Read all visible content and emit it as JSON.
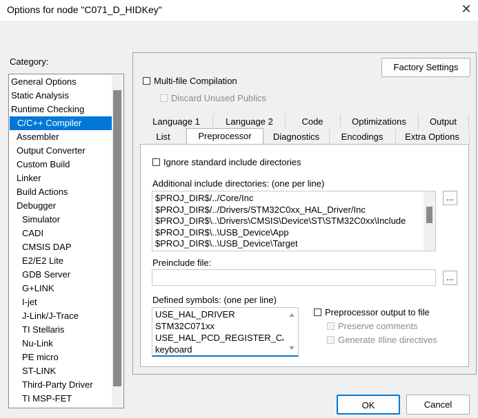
{
  "window": {
    "title": "Options for node \"C071_D_HIDKey\""
  },
  "category": {
    "label": "Category:",
    "items": [
      "General Options",
      "Static Analysis",
      "Runtime Checking",
      "C/C++ Compiler",
      "Assembler",
      "Output Converter",
      "Custom Build",
      "Linker",
      "Build Actions",
      "Debugger",
      "Simulator",
      "CADI",
      "CMSIS DAP",
      "E2/E2 Lite",
      "GDB Server",
      "G+LINK",
      "I-jet",
      "J-Link/J-Trace",
      "TI Stellaris",
      "Nu-Link",
      "PE micro",
      "ST-LINK",
      "Third-Party Driver",
      "TI MSP-FET"
    ],
    "selected": "C/C++ Compiler"
  },
  "factory_settings_label": "Factory Settings",
  "multifile": {
    "label": "Multi-file Compilation",
    "checked": false
  },
  "discard": {
    "label": "Discard Unused Publics",
    "checked": false
  },
  "tabs_row1": [
    "Language 1",
    "Language 2",
    "Code",
    "Optimizations",
    "Output"
  ],
  "tabs_row2": [
    "List",
    "Preprocessor",
    "Diagnostics",
    "Encodings",
    "Extra Options"
  ],
  "active_tab": "Preprocessor",
  "preproc": {
    "ignore_std": {
      "label": "Ignore standard include directories",
      "checked": false
    },
    "include_label": "Additional include directories: (one per line)",
    "include_lines": [
      "$PROJ_DIR$/../Core/Inc",
      "$PROJ_DIR$/../Drivers/STM32C0xx_HAL_Driver/Inc",
      "$PROJ_DIR$\\..\\Drivers\\CMSIS\\Device\\ST\\STM32C0xx\\Include",
      "$PROJ_DIR$\\..\\USB_Device\\App",
      "$PROJ_DIR$\\..\\USB_Device\\Target"
    ],
    "preinclude_label": "Preinclude file:",
    "preinclude_value": "",
    "ellipsis": "...",
    "defined_label": "Defined symbols: (one per line)",
    "defined_lines": [
      "USE_HAL_DRIVER",
      "STM32C071xx",
      "USE_HAL_PCD_REGISTER_CALLBACKS",
      "keyboard"
    ],
    "preproc_output": {
      "label": "Preprocessor output to file",
      "checked": false
    },
    "preserve_comments": {
      "label": "Preserve comments",
      "checked": false
    },
    "generate_line": {
      "label": "Generate #line directives",
      "checked": false
    }
  },
  "buttons": {
    "ok": "OK",
    "cancel": "Cancel"
  }
}
